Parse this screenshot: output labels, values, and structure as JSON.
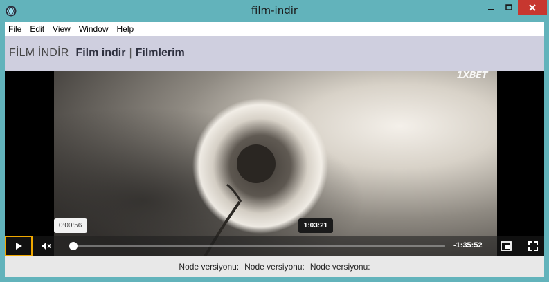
{
  "window": {
    "title": "film-indir",
    "icon": "electron-atom-icon",
    "colors": {
      "frame": "#62b3bb",
      "close": "#c7372f"
    }
  },
  "menu": {
    "items": [
      "File",
      "Edit",
      "View",
      "Window",
      "Help"
    ]
  },
  "nav": {
    "brand": "FİLM İNDİR",
    "link1": "Film indir",
    "separator": "|",
    "link2": "Filmlerim",
    "background": "#cfcfdf"
  },
  "video": {
    "watermark": "1XBET",
    "current_time": "0:00:56",
    "hover_time": "1:03:21",
    "remaining_time": "-1:35:52",
    "progress_fraction": 0.01,
    "hover_fraction": 0.66,
    "accent": "#f0a800"
  },
  "footer": {
    "labels": [
      "Node versiyonu:",
      "Node versiyonu:",
      "Node versiyonu:"
    ]
  }
}
